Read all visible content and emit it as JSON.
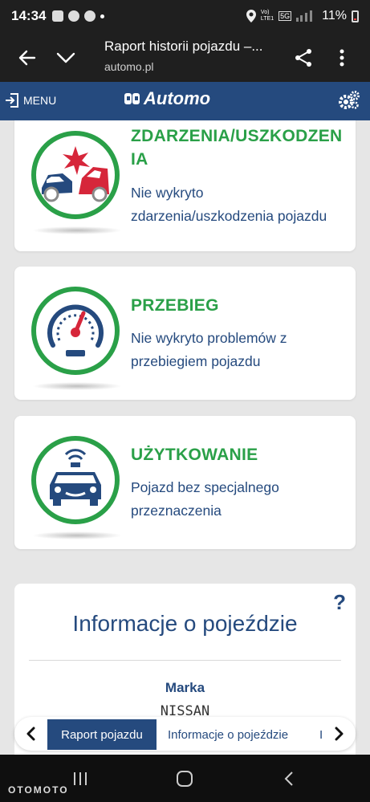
{
  "status_bar": {
    "time": "14:34",
    "net1": "Vo)",
    "net2": "LTE1",
    "g5": "5G",
    "battery": "11%"
  },
  "browser": {
    "title": "Raport historii pojazdu –...",
    "url": "automo.pl"
  },
  "site_nav": {
    "menu_label": "MENU",
    "logo_text": "Automo"
  },
  "cards": [
    {
      "title_line1": "ZDARZENIA/USZKODZEN",
      "title_line2": "IA",
      "desc_line1": "Nie wykryto",
      "desc_line2": "zdarzenia/uszkodzenia pojazdu"
    },
    {
      "title_line1": "PRZEBIEG",
      "desc_line1": "Nie wykryto problemów z",
      "desc_line2": "przebiegiem pojazdu"
    },
    {
      "title_line1": "UŻYTKOWANIE",
      "desc_line1": "Pojazd bez specjalnego",
      "desc_line2": "przeznaczenia"
    }
  ],
  "info": {
    "help": "?",
    "heading": "Informacje o pojeździe",
    "label": "Marka",
    "value": "NISSAN"
  },
  "tabs": [
    "Raport pojazdu",
    "Informacje o pojeździe",
    "I"
  ],
  "watermark": "OTOMOTO",
  "colors": {
    "navy": "#254a7e",
    "green": "#2aa048",
    "red": "#d6263a"
  }
}
